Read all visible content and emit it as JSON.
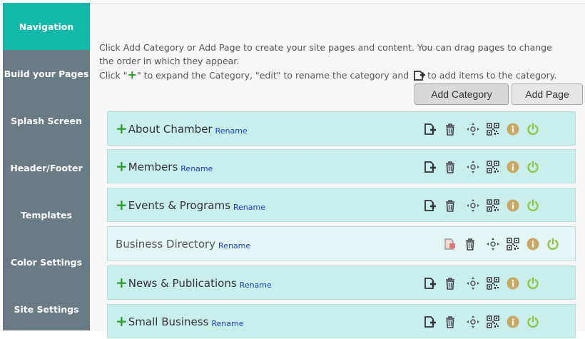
{
  "sidebar": {
    "items": [
      {
        "label": "Navigation",
        "active": true
      },
      {
        "label": "Build your Pages",
        "active": false
      },
      {
        "label": "Splash Screen",
        "active": false
      },
      {
        "label": "Header/Footer",
        "active": false
      },
      {
        "label": "Templates",
        "active": false
      },
      {
        "label": "Color Settings",
        "active": false
      },
      {
        "label": "Site Settings",
        "active": false
      }
    ]
  },
  "intro": {
    "line1": "Click Add Category or Add Page to create your site pages and content. You can drag pages to change the order in which they appear.",
    "line2_a": "Click \"",
    "line2_plus": "+",
    "line2_b": "\" to expand the Category, \"edit\" to rename the category and ",
    "line2_c": "to add items to the category."
  },
  "buttons": {
    "add_category": "Add Category",
    "add_page": "Add Page"
  },
  "rows": [
    {
      "title": "About Chamber",
      "rename": "Rename",
      "expandable": true
    },
    {
      "title": "Members",
      "rename": "Rename",
      "expandable": true
    },
    {
      "title": "Events & Programs",
      "rename": "Rename",
      "expandable": true
    },
    {
      "title": "Business Directory",
      "rename": "Rename",
      "expandable": false
    },
    {
      "title": "News & Publications",
      "rename": "Rename",
      "expandable": true
    },
    {
      "title": "Small Business",
      "rename": "Rename",
      "expandable": true
    }
  ],
  "row_icons": [
    "add-item-icon",
    "trash-icon",
    "move-icon",
    "qr-code-icon",
    "info-icon",
    "power-icon"
  ],
  "colors": {
    "sidebar": "#6b7b83",
    "sidebar_active": "#11b9a9",
    "row": "#c9efec",
    "row_light": "#e4f6f5",
    "plus": "#2ba02b",
    "rename_link": "#1a3fd0",
    "info_circle": "#c8a867",
    "power": "#8cc63f"
  }
}
